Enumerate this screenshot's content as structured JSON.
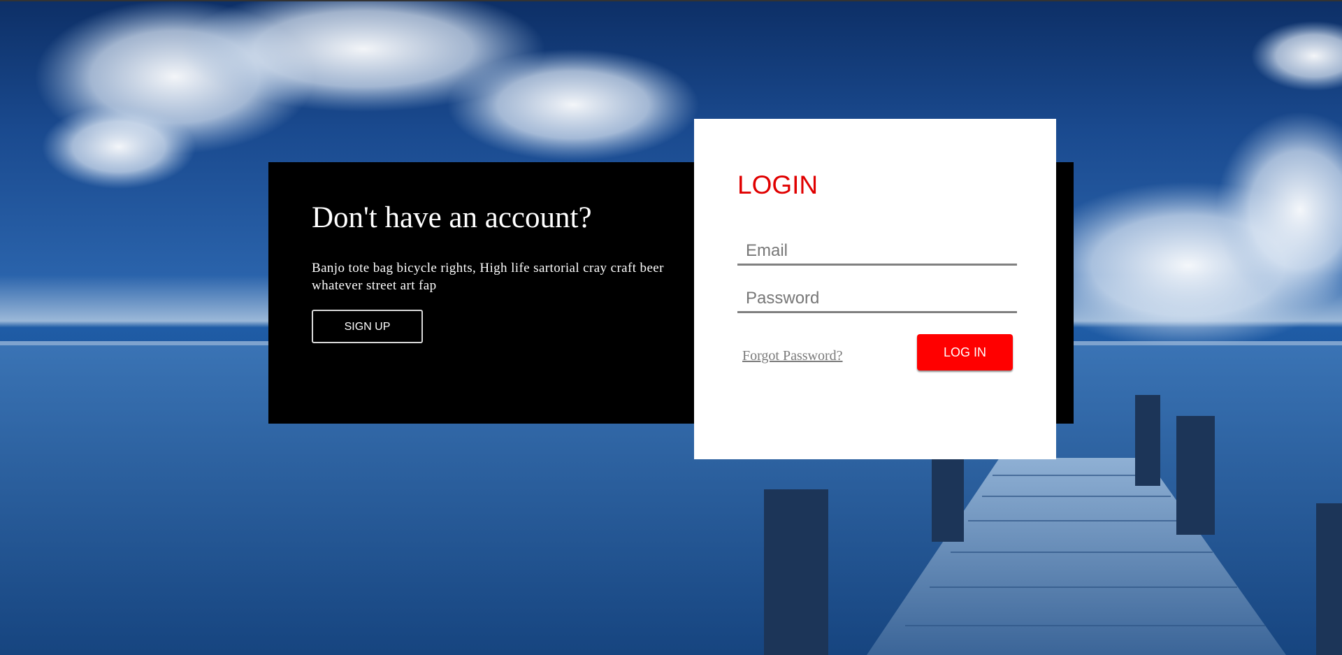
{
  "signup": {
    "title": "Don't have an account?",
    "description": "Banjo tote bag bicycle rights, High life sartorial cray craft beer whatever street art fap",
    "button_label": "SIGN UP"
  },
  "login": {
    "title": "LOGIN",
    "email_placeholder": "Email",
    "password_placeholder": "Password",
    "forgot_label": "Forgot Password?",
    "button_label": "LOG IN"
  },
  "colors": {
    "accent": "#ff0000",
    "title": "#e00000",
    "panel": "#000000",
    "card": "#ffffff"
  }
}
